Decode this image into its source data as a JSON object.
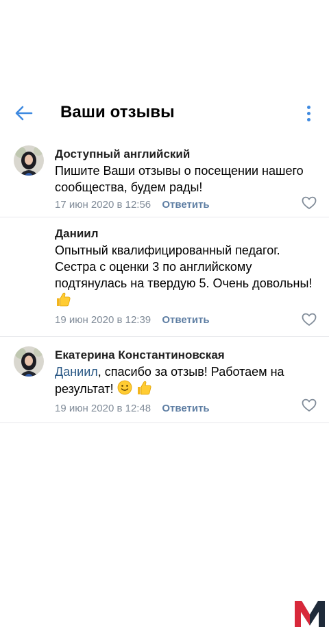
{
  "header": {
    "title": "Ваши отзывы"
  },
  "comments": [
    {
      "author": "Доступный английский",
      "text": "Пишите Ваши отзывы о посещении нашего сообщества, будем рады!",
      "date": "17 июн 2020 в 12:56",
      "reply_label": "Ответить",
      "has_avatar": true
    },
    {
      "author": "Даниил",
      "text": "Опытный квалифицированный педагог. Сестра с оценки 3 по английскому подтянулась на твердую 5. Очень довольны!",
      "date": "19 июн 2020 в 12:39",
      "reply_label": "Ответить",
      "has_avatar": false,
      "emojis": [
        "thumbs-up"
      ]
    },
    {
      "author": "Екатерина Константиновская",
      "mention": "Даниил",
      "text": ", спасибо за отзыв! Работаем на результат!",
      "date": "19 июн 2020 в 12:48",
      "reply_label": "Ответить",
      "has_avatar": true,
      "emojis": [
        "slightly-smiling-face",
        "thumbs-up"
      ]
    }
  ],
  "colors": {
    "accent": "#3f8ae0",
    "meta": "#818c99",
    "reply": "#5e7ea3",
    "mention": "#2a5885",
    "separator": "#e7e8ec"
  },
  "icons": [
    "back-arrow-icon",
    "more-vertical-icon",
    "heart-icon",
    "thumbs-up-emoji",
    "smile-emoji",
    "m-logo"
  ]
}
